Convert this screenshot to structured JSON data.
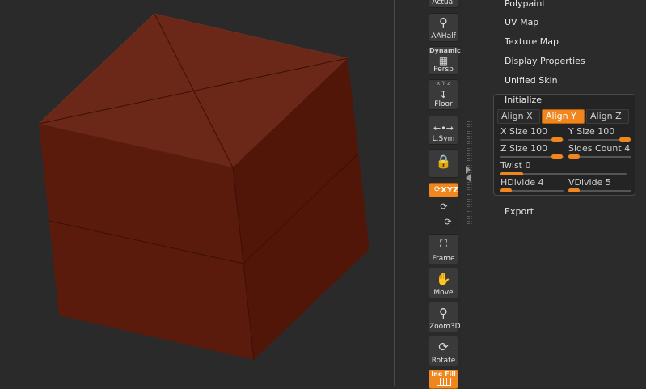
{
  "toolbar": {
    "actual_label": "Actual",
    "aahalf_label": "AAHalf",
    "persp_top_label": "Dynamic",
    "persp_label": "Persp",
    "floor_axes_label": "x Y z",
    "floor_label": "Floor",
    "lsym_label": "L.Sym",
    "xyz_label": "XYZ",
    "frame_label": "Frame",
    "move_label": "Move",
    "zoom3d_label": "Zoom3D",
    "rotate_label": "Rotate",
    "line_fill_label": "Ine Fill"
  },
  "menu": {
    "polypaint": "Polypaint",
    "uvmap": "UV Map",
    "texture_map": "Texture Map",
    "display_properties": "Display Properties",
    "unified_skin": "Unified Skin",
    "initialize": "Initialize",
    "export": "Export"
  },
  "initialize": {
    "align_x": "Align X",
    "align_y": "Align Y",
    "align_z": "Align Z",
    "x_size_label": "X Size",
    "x_size_value": "100",
    "y_size_label": "Y Size",
    "y_size_value": "100",
    "z_size_label": "Z Size",
    "z_size_value": "100",
    "sides_count_label": "Sides Count",
    "sides_count_value": "4",
    "twist_label": "Twist",
    "twist_value": "0",
    "hdivide_label": "HDivide",
    "hdivide_value": "4",
    "vdivide_label": "VDivide",
    "vdivide_value": "5"
  },
  "colors": {
    "accent": "#f0861e",
    "cube_front": "#5c1c0e",
    "cube_top": "#6e2a1c",
    "background": "#2a2a2a"
  }
}
